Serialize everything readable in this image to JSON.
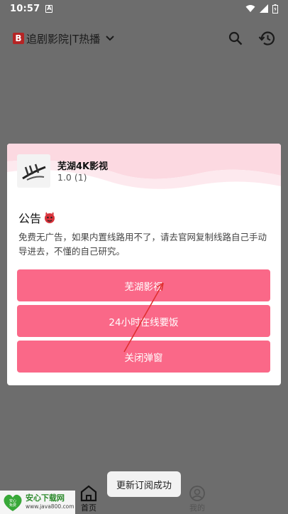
{
  "status_bar": {
    "time": "10:57",
    "notification_icon": "A",
    "icons": [
      "wifi-icon",
      "signal-icon",
      "battery-icon"
    ]
  },
  "header": {
    "brand_badge": "B",
    "title": "追剧影院|T热播",
    "actions": [
      "search-icon",
      "history-icon"
    ]
  },
  "dialog": {
    "app_name": "芜湖4K影视",
    "app_version": "1.0 (1)",
    "notice_title": "公告",
    "notice_body": "免费无广告，如果内置线路用不了，请去官网复制线路自己手动导进去，不懂的自己研究。",
    "buttons": [
      "芜湖影视",
      "24小时在线要饭",
      "关闭弹窗"
    ]
  },
  "toast": "更新订阅成功",
  "bottom_nav": {
    "home": "首页",
    "mine": "我的"
  },
  "watermark": {
    "main": "安心下载网",
    "url": "www.java800.com",
    "logo_text": "安心\n免费"
  },
  "colors": {
    "button": "#fa6888",
    "scrim": "#6d6d6d",
    "brand_badge": "#b52424",
    "annotation_arrow": "#e03030"
  }
}
